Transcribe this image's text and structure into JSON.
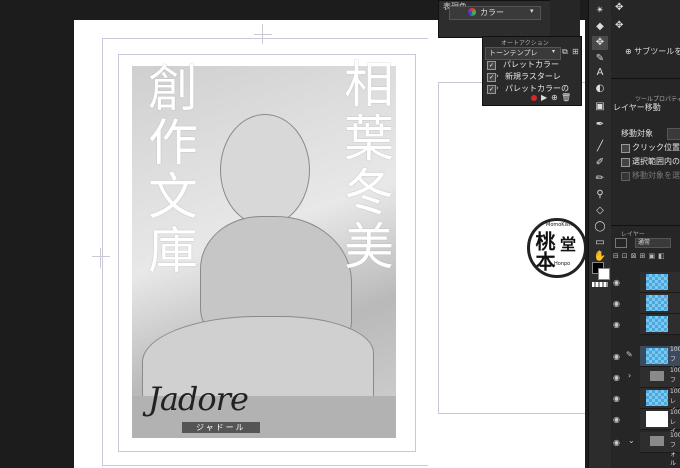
{
  "canvas": {
    "vertical_title_1": "相葉冬美",
    "vertical_title_2": "創作文庫",
    "logo_script": "Jadore",
    "logo_caption": "ジャドール",
    "stamp_main": "桃本",
    "stamp_side": "堂",
    "stamp_arc_top": "MomoKishi",
    "stamp_arc_bottom": "Honpo"
  },
  "top_property": {
    "heading": "表現色",
    "color_mode": "カラー"
  },
  "auto_action": {
    "title": "オートアクション",
    "set_name": "トーンテンプレ",
    "items": [
      "パレットカラー",
      "新規ラスターレ",
      "パレットカラーの"
    ]
  },
  "sub_tool": {
    "add_label": "サブツールを始",
    "tool_property_title": "ツールプロパティ[レイ",
    "tool_name": "レイヤー移動",
    "move_target_label": "移動対象",
    "option_1": "クリック位置にあるレ",
    "option_2": "選択範囲内のレイ",
    "option_3": "移動対象を選択"
  },
  "layer_panel": {
    "title": "レイヤー",
    "blend_mode": "通常",
    "rows": [
      {
        "opacity": "",
        "name": "",
        "kind": "tone"
      },
      {
        "opacity": "",
        "name": "",
        "kind": "tone"
      },
      {
        "opacity": "",
        "name": "",
        "kind": "tone"
      },
      {
        "opacity": "100",
        "name": "フォル",
        "kind": "tone"
      },
      {
        "opacity": "100",
        "name": "フォル",
        "kind": "folder"
      },
      {
        "opacity": "100",
        "name": "レイ",
        "kind": "tone"
      },
      {
        "opacity": "100",
        "name": "レイヤ",
        "kind": "white"
      },
      {
        "opacity": "100",
        "name": "フォル",
        "kind": "folder"
      }
    ]
  },
  "colors": {
    "accent_blue": "#2a78d6",
    "record_red": "#d42a2a",
    "tone_cyan": "#5ab7ea"
  }
}
